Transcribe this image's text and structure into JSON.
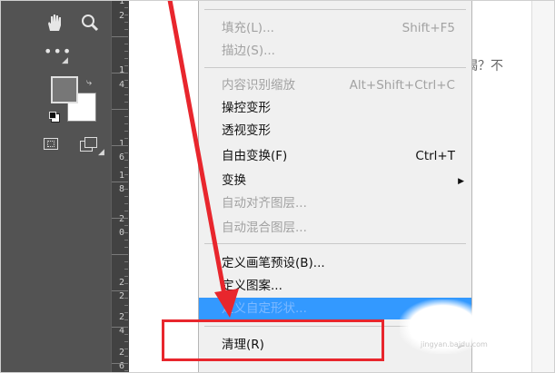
{
  "ruler": {
    "numbers": [
      "1",
      "0",
      "1",
      "2",
      "1",
      "4",
      "1",
      "6",
      "1",
      "8",
      "2",
      "0",
      "2",
      "2",
      "2",
      "4",
      "2",
      "6"
    ]
  },
  "background_text": "蝎？不",
  "menu": {
    "items": [
      {
        "label": "填充(L)...",
        "shortcut": "Shift+F5",
        "enabled": false
      },
      {
        "label": "描边(S)...",
        "shortcut": "",
        "enabled": false
      },
      {
        "label": "内容识别缩放",
        "shortcut": "Alt+Shift+Ctrl+C",
        "enabled": false
      },
      {
        "label": "操控变形",
        "shortcut": "",
        "enabled": true
      },
      {
        "label": "透视变形",
        "shortcut": "",
        "enabled": true
      },
      {
        "label": "自由变换(F)",
        "shortcut": "Ctrl+T",
        "enabled": true
      },
      {
        "label": "变换",
        "shortcut": "",
        "enabled": true,
        "submenu": true
      },
      {
        "label": "自动对齐图层...",
        "shortcut": "",
        "enabled": false
      },
      {
        "label": "自动混合图层...",
        "shortcut": "",
        "enabled": false
      },
      {
        "label": "定义画笔预设(B)...",
        "shortcut": "",
        "enabled": true
      },
      {
        "label": "定义图案...",
        "shortcut": "",
        "enabled": true
      },
      {
        "label": "定义自定形状...",
        "shortcut": "",
        "enabled": false,
        "highlighted": true
      },
      {
        "label": "清理(R)",
        "shortcut": "",
        "enabled": true,
        "submenu": true
      }
    ]
  },
  "watermark": "jingyan.baidu.com",
  "colors": {
    "toolbar": "#535353",
    "ruler": "#424242",
    "menu_bg": "#f0f0f0",
    "highlight": "#3399ff",
    "annotation_red": "#e8262d"
  },
  "icons": [
    "hand-icon",
    "zoom-icon",
    "more-tools-icon",
    "foreground-color-swatch",
    "background-color-swatch",
    "swap-colors-icon",
    "default-colors-icon",
    "quick-mask-icon",
    "screen-mode-icon"
  ]
}
